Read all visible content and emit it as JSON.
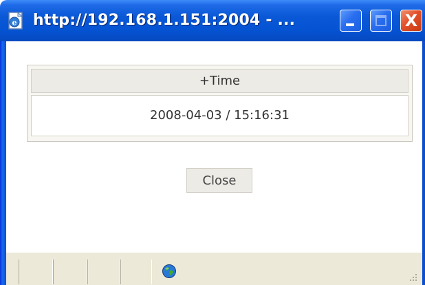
{
  "window": {
    "title": "http://192.168.1.151:2004 - ...",
    "icon": "ie-page-icon",
    "controls": {
      "minimize": "minimize-icon",
      "maximize": "maximize-icon",
      "close": "X"
    }
  },
  "info": {
    "header": "+Time",
    "value": "2008-04-03 / 15:16:31"
  },
  "actions": {
    "close_label": "Close"
  },
  "statusbar": {
    "zone_icon": "globe-icon"
  },
  "colors": {
    "titlebar": "#0554d4",
    "close_button": "#e2502a",
    "table_header_bg": "#ecebe6",
    "statusbar_bg": "#ece9d8"
  }
}
